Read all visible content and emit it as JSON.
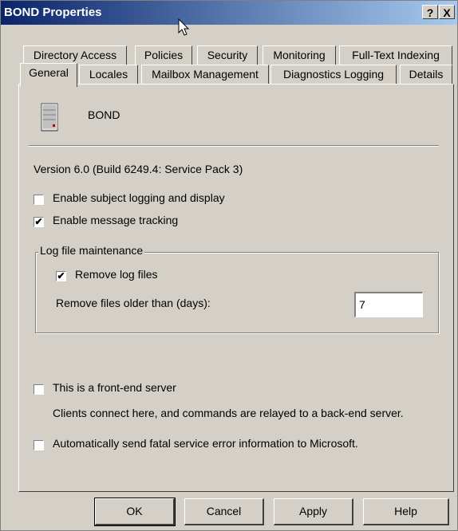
{
  "window": {
    "title": "BOND Properties",
    "help_btn": "?",
    "close_btn": "X"
  },
  "tabs_row1": [
    "Directory Access",
    "Policies",
    "Security",
    "Monitoring",
    "Full-Text Indexing"
  ],
  "tabs_row2": [
    "General",
    "Locales",
    "Mailbox Management",
    "Diagnostics Logging",
    "Details"
  ],
  "active_tab": "General",
  "general": {
    "server_name": "BOND",
    "server_icon": "server-icon",
    "version": "Version 6.0 (Build 6249.4: Service Pack 3)",
    "subject_logging": {
      "label": "Enable subject logging and display",
      "checked": false
    },
    "message_tracking": {
      "label": "Enable message tracking",
      "checked": true
    },
    "log_group": {
      "label": "Log file maintenance",
      "remove_logs": {
        "label": "Remove log files",
        "checked": true
      },
      "days_label": "Remove files older than (days):",
      "days_value": "7"
    },
    "front_end": {
      "label": "This is a front-end server",
      "checked": false
    },
    "front_end_desc": "Clients connect here, and commands are relayed to a back-end server.",
    "send_error": {
      "label": "Automatically send fatal service error information to Microsoft.",
      "checked": false
    }
  },
  "buttons": {
    "ok": "OK",
    "cancel": "Cancel",
    "apply": "Apply",
    "help": "Help"
  },
  "colors": {
    "title_start": "#0a246a",
    "title_end": "#a6caf0",
    "face": "#d4d0c8"
  }
}
